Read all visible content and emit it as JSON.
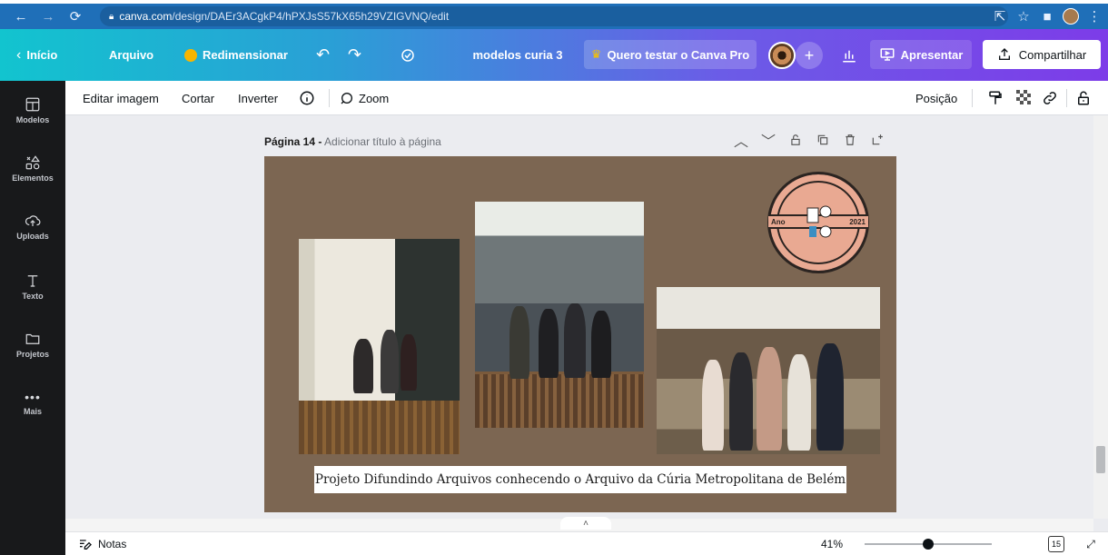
{
  "browser": {
    "url_host": "canva.com",
    "url_path": "/design/DAEr3ACgkP4/hPXJsS57kX65h29VZIGVNQ/edit"
  },
  "canva_bar": {
    "home": "Início",
    "file": "Arquivo",
    "resize": "Redimensionar",
    "doc_title": "modelos curia 3",
    "pro": "Quero testar o Canva Pro",
    "present": "Apresentar",
    "share": "Compartilhar"
  },
  "sidebar": {
    "items": [
      {
        "label": "Modelos",
        "icon": "templates-icon"
      },
      {
        "label": "Elementos",
        "icon": "elements-icon"
      },
      {
        "label": "Uploads",
        "icon": "upload-cloud-icon"
      },
      {
        "label": "Texto",
        "icon": "text-icon"
      },
      {
        "label": "Projetos",
        "icon": "folder-icon"
      },
      {
        "label": "Mais",
        "icon": "more-dots-icon"
      }
    ]
  },
  "toolbar": {
    "edit_image": "Editar imagem",
    "crop": "Cortar",
    "flip": "Inverter",
    "zoom": "Zoom",
    "position": "Posição"
  },
  "page": {
    "label": "Página 14 -",
    "subtitle": "Adicionar título à página",
    "caption": "Projeto Difundindo Arquivos conhecendo o Arquivo da Cúria Metropolitana de Belém",
    "logo_left": "Ano",
    "logo_right": "2021"
  },
  "bottom": {
    "notes": "Notas",
    "zoom": "41%",
    "page_count": "15"
  }
}
